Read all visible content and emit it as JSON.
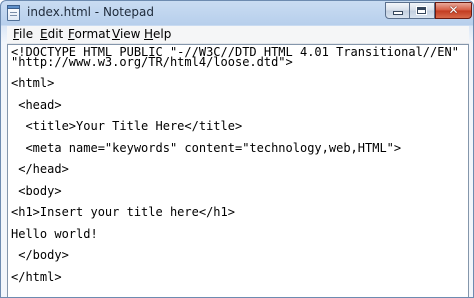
{
  "window": {
    "title": "index.html - Notepad",
    "close_glyph": "✕"
  },
  "menu": {
    "items": [
      {
        "key": "file",
        "accel": "F",
        "rest": "ile"
      },
      {
        "key": "edit",
        "accel": "E",
        "rest": "dit"
      },
      {
        "key": "format",
        "accel": "F",
        "rest": "ormat"
      },
      {
        "key": "view",
        "accel": "V",
        "rest": "iew"
      },
      {
        "key": "help",
        "accel": "H",
        "rest": "elp"
      }
    ]
  },
  "document": {
    "lines": [
      "<!DOCTYPE HTML PUBLIC \"-//W3C//DTD HTML 4.01 Transitional//EN\"",
      "\"http://www.w3.org/TR/html4/loose.dtd\">",
      "<html>",
      " <head>",
      "  <title>Your Title Here</title>",
      "  <meta name=\"keywords\" content=\"technology,web,HTML\">",
      " </head>",
      " <body>",
      "<h1>Insert your title here</h1>",
      "Hello world!",
      " </body>",
      "</html>"
    ]
  },
  "icons": {
    "app": "notepad-icon",
    "minimize": "minimize-icon",
    "maximize": "maximize-icon",
    "close": "close-icon"
  },
  "colors": {
    "titlebar": "#c4d8f0",
    "close_button": "#c8432a",
    "editor_background": "#ffffff"
  }
}
